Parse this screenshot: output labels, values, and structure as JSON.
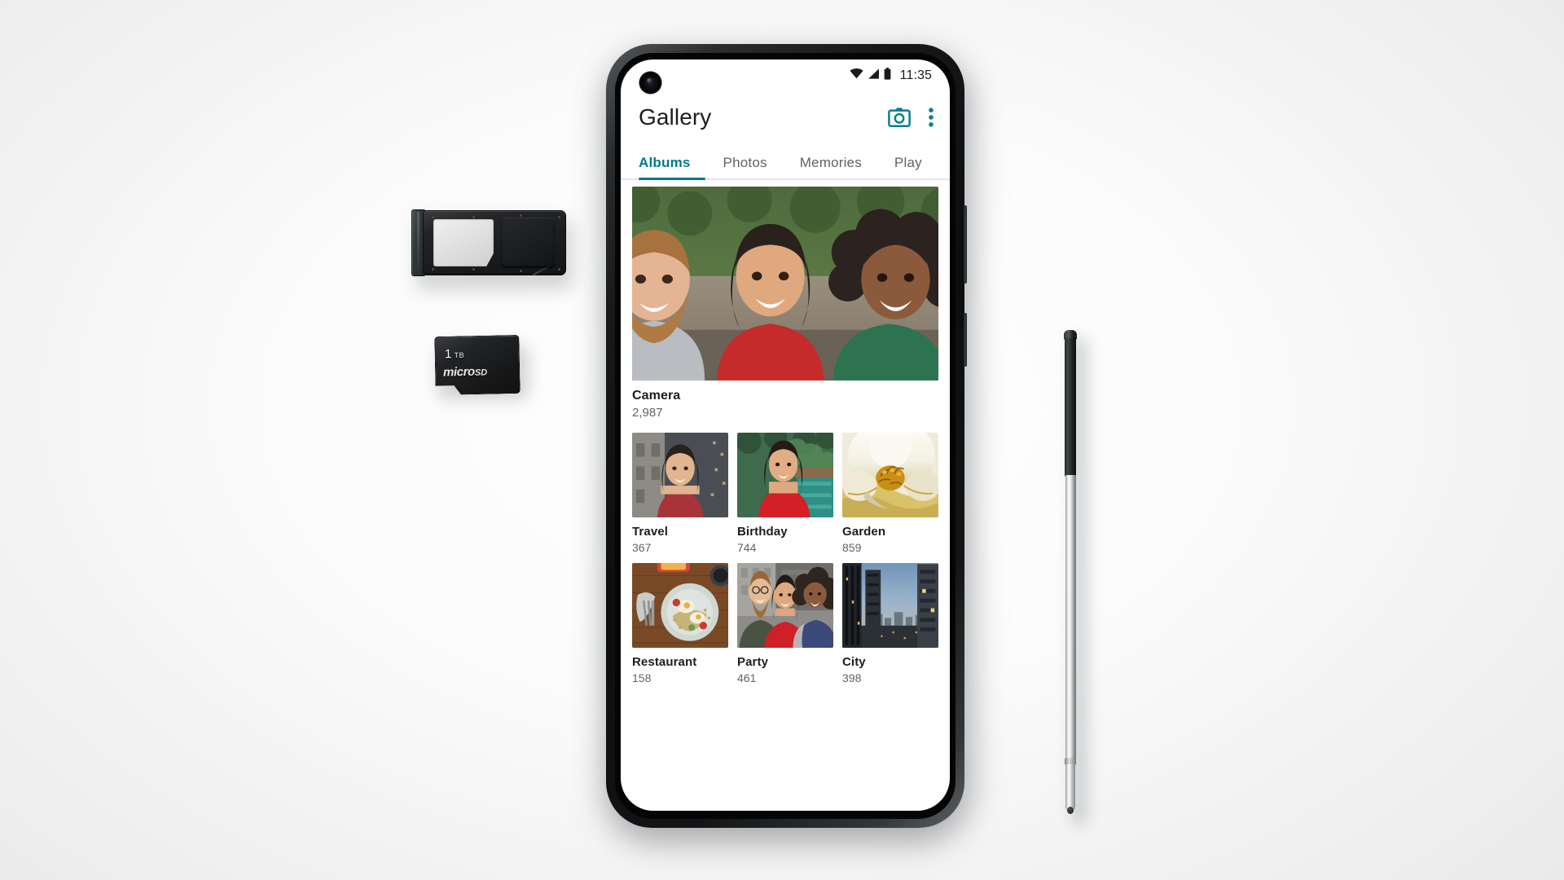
{
  "scene": {
    "background_color": "#f2f2f2",
    "objects": [
      {
        "name": "sim-tray",
        "label": ""
      },
      {
        "name": "microsd-card",
        "capacity": "1",
        "capacity_unit": "TB",
        "brand_mark": "micro",
        "brand_mark_sub": "SD"
      },
      {
        "name": "stylus",
        "label": ""
      }
    ]
  },
  "phone": {
    "statusbar": {
      "time": "11:35",
      "icons": [
        "wifi-icon",
        "cell-signal-icon",
        "battery-icon"
      ]
    },
    "appbar": {
      "title": "Gallery",
      "actions": [
        {
          "name": "camera-icon",
          "label": "Camera"
        },
        {
          "name": "overflow-menu-icon",
          "label": "More options"
        }
      ]
    },
    "tabs": {
      "items": [
        {
          "label": "Albums",
          "active": true
        },
        {
          "label": "Photos",
          "active": false
        },
        {
          "label": "Memories",
          "active": false
        },
        {
          "label": "Play",
          "active": false
        }
      ],
      "active_color": "#00788f",
      "inactive_color": "#5f6368"
    },
    "albums": {
      "featured": {
        "name": "Camera",
        "count": "2,987",
        "thumbnail": "three-friends-selfie"
      },
      "items": [
        {
          "name": "Travel",
          "count": "367",
          "thumbnail": "woman-city-portrait"
        },
        {
          "name": "Birthday",
          "count": "744",
          "thumbnail": "woman-red-dress-pool"
        },
        {
          "name": "Garden",
          "count": "859",
          "thumbnail": "white-magnolia-flower"
        },
        {
          "name": "Restaurant",
          "count": "158",
          "thumbnail": "food-plate-table"
        },
        {
          "name": "Party",
          "count": "461",
          "thumbnail": "group-friends-party"
        },
        {
          "name": "City",
          "count": "398",
          "thumbnail": "city-skyline-dusk"
        }
      ]
    }
  }
}
